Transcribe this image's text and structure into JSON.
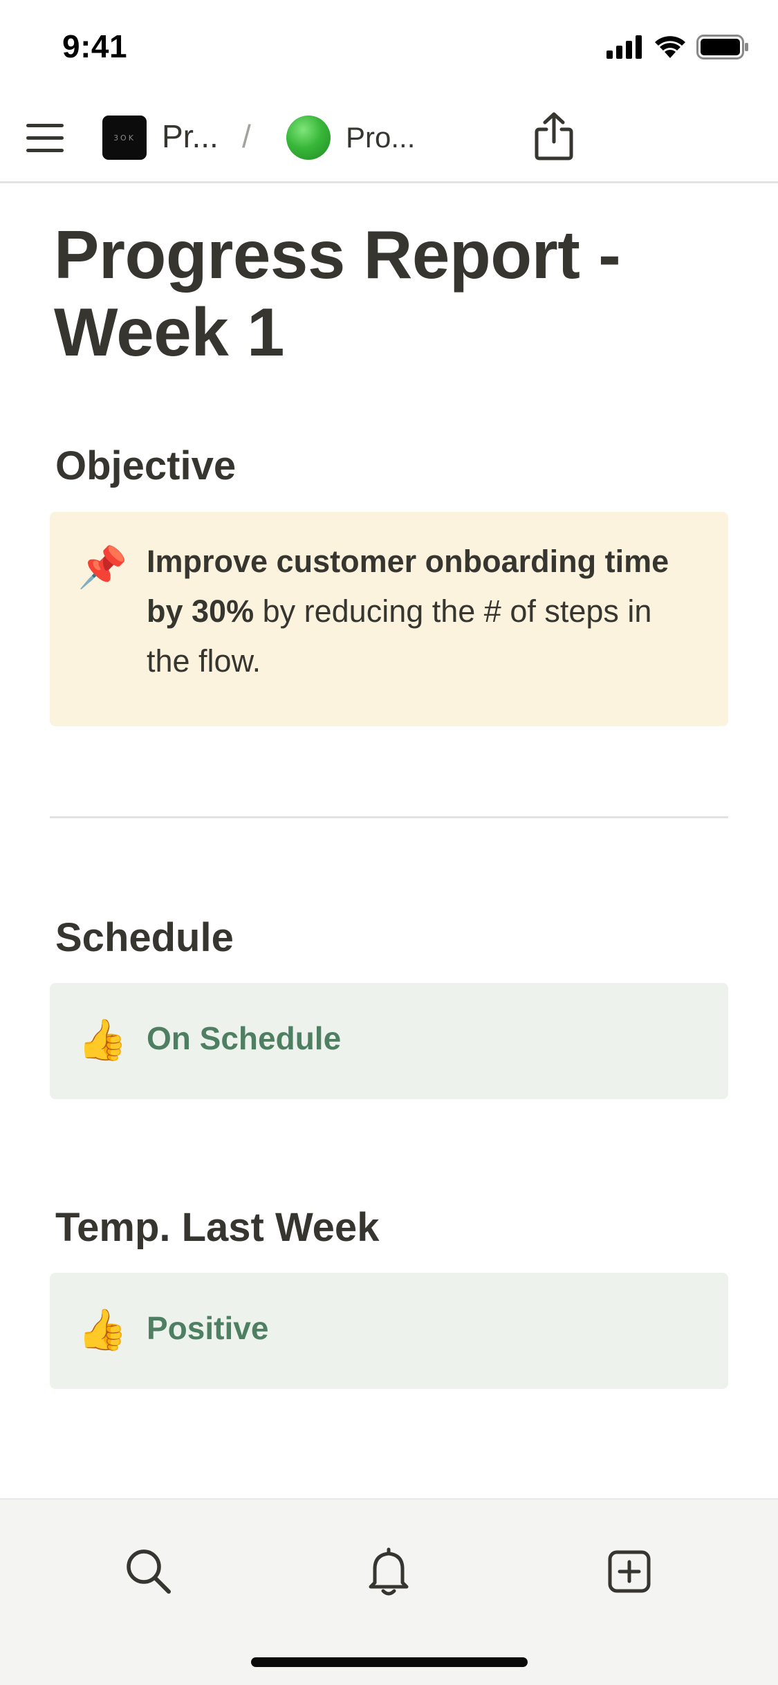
{
  "status_bar": {
    "time": "9:41"
  },
  "nav": {
    "workspace_logo_text": "3OK",
    "breadcrumb_1": "Pr...",
    "separator": "/",
    "breadcrumb_2": "Pro...",
    "page_icon_color": "#2fa433"
  },
  "page": {
    "title": "Progress Report - Week 1",
    "objective": {
      "heading": "Objective",
      "icon": "📌",
      "text_bold": "Improve customer onboarding time by 30%",
      "text_rest": " by reducing the # of steps in the flow."
    },
    "schedule": {
      "heading": "Schedule",
      "icon": "👍",
      "value": "On Schedule"
    },
    "temperature": {
      "heading": "Temp. Last Week",
      "icon": "👍",
      "value": "Positive"
    }
  },
  "colors": {
    "callout_yellow": "#fbf3dd",
    "callout_green": "#edf3ec",
    "green_text": "#4f7f63",
    "body_text": "#37352f"
  },
  "tab_bar": {
    "icons": [
      "search-icon",
      "bell-icon",
      "new-page-icon"
    ]
  }
}
